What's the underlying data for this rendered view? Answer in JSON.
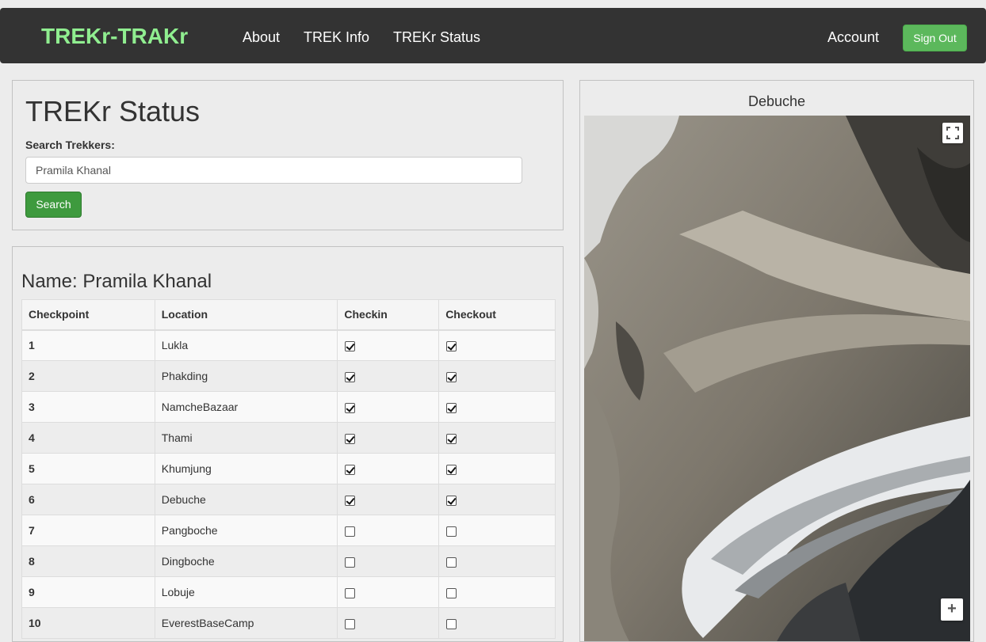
{
  "navbar": {
    "brand": "TREKr-TRAKr",
    "links": [
      "About",
      "TREK Info",
      "TREKr Status"
    ],
    "account": "Account",
    "sign_out": "Sign Out"
  },
  "search_panel": {
    "title": "TREKr Status",
    "label": "Search Trekkers:",
    "input_value": "Pramila Khanal",
    "button": "Search"
  },
  "results": {
    "name_heading": "Name: Pramila Khanal",
    "columns": [
      "Checkpoint",
      "Location",
      "Checkin",
      "Checkout"
    ],
    "rows": [
      {
        "checkpoint": "1",
        "location": "Lukla",
        "checkin": true,
        "checkout": true
      },
      {
        "checkpoint": "2",
        "location": "Phakding",
        "checkin": true,
        "checkout": true
      },
      {
        "checkpoint": "3",
        "location": "NamcheBazaar",
        "checkin": true,
        "checkout": true
      },
      {
        "checkpoint": "4",
        "location": "Thami",
        "checkin": true,
        "checkout": true
      },
      {
        "checkpoint": "5",
        "location": "Khumjung",
        "checkin": true,
        "checkout": true
      },
      {
        "checkpoint": "6",
        "location": "Debuche",
        "checkin": true,
        "checkout": true
      },
      {
        "checkpoint": "7",
        "location": "Pangboche",
        "checkin": false,
        "checkout": false
      },
      {
        "checkpoint": "8",
        "location": "Dingboche",
        "checkin": false,
        "checkout": false
      },
      {
        "checkpoint": "9",
        "location": "Lobuje",
        "checkin": false,
        "checkout": false
      },
      {
        "checkpoint": "10",
        "location": "EverestBaseCamp",
        "checkin": false,
        "checkout": false
      }
    ]
  },
  "map": {
    "title": "Debuche",
    "zoom_in": "+"
  }
}
